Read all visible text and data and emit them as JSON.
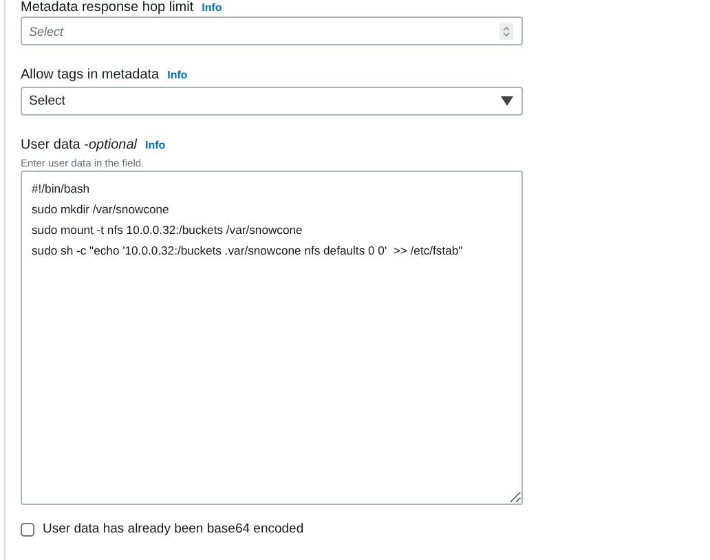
{
  "hop_limit": {
    "label": "Metadata response hop limit",
    "info": "Info",
    "placeholder": "Select"
  },
  "allow_tags": {
    "label": "Allow tags in metadata",
    "info": "Info",
    "value": "Select"
  },
  "user_data": {
    "label": "User data - ",
    "label_optional": "optional",
    "info": "Info",
    "hint": "Enter user data in the field.",
    "lines": [
      "#!/bin/bash",
      "sudo mkdir /var/snowcone",
      "sudo mount -t nfs 10.0.0.32:/buckets /var/snowcone",
      "sudo sh -c \"echo '10.0.0.32:/buckets .var/snowcone nfs defaults 0 0'  >> /etc/fstab\""
    ]
  },
  "base64": {
    "label": "User data has already been base64 encoded",
    "checked": false
  }
}
